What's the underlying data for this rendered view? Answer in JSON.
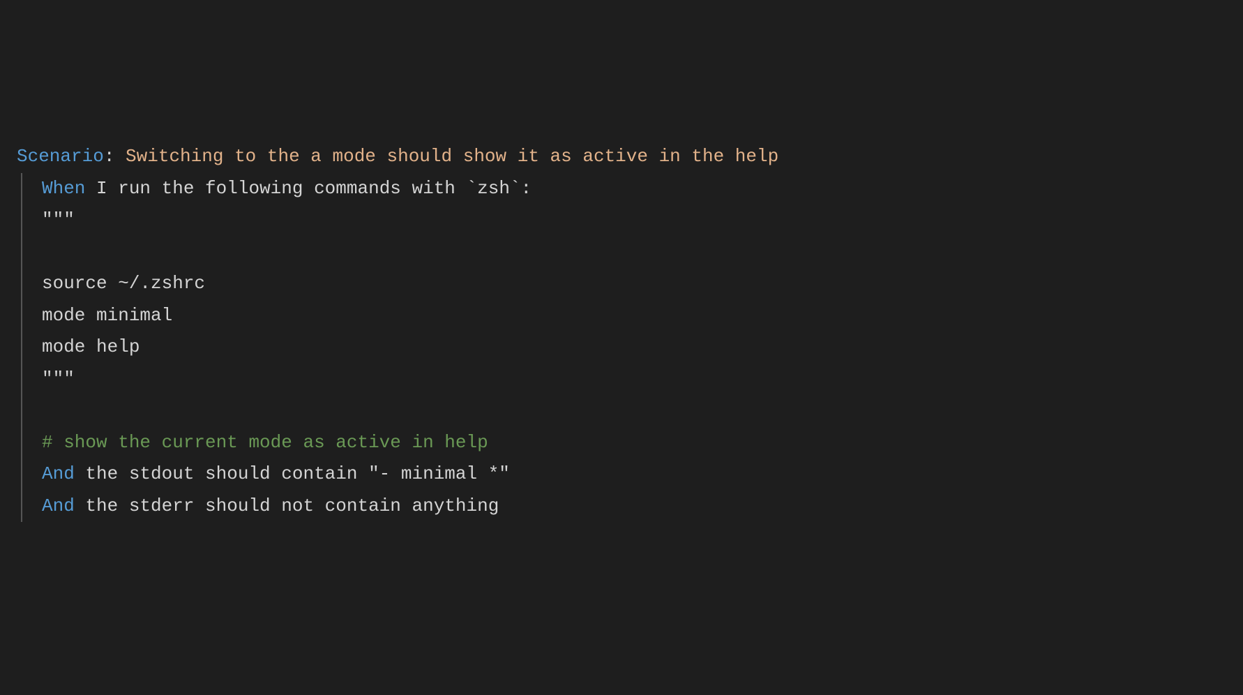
{
  "scenario": {
    "keyword": "Scenario",
    "colon": ":",
    "title": " Switching to the a mode should show it as active in the help"
  },
  "steps": {
    "when": {
      "keyword": "When",
      "text": " I run the following commands with `zsh`:"
    },
    "docstring": {
      "open": "\"\"\"",
      "blank": "",
      "line1": "source ~/.zshrc",
      "line2": "mode minimal",
      "line3": "mode help",
      "close": "\"\"\""
    },
    "blank_after": "",
    "comment": "# show the current mode as active in help",
    "and1": {
      "keyword": "And",
      "text": " the stdout should contain \"- minimal *\""
    },
    "and2": {
      "keyword": "And",
      "text": " the stderr should not contain anything"
    }
  }
}
